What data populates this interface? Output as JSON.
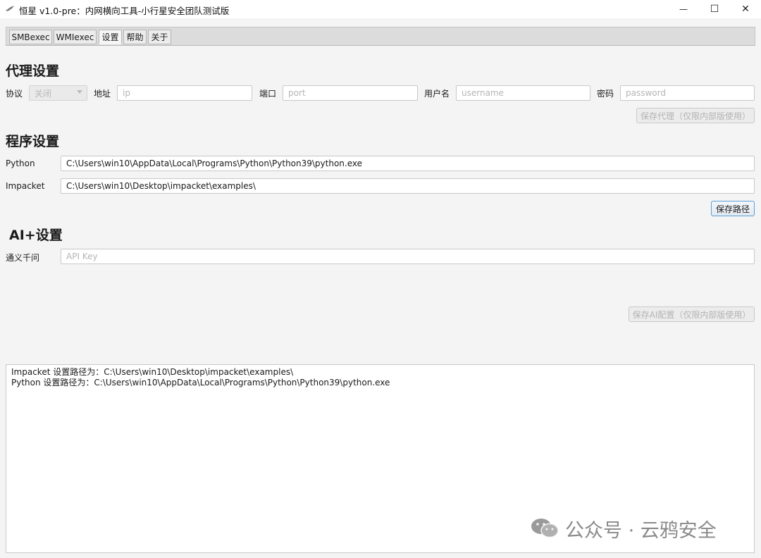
{
  "window": {
    "title": "恒星 v1.0-pre：内网横向工具-小行星安全团队测试版",
    "controls": {
      "minimize": "—",
      "maximize": "☐",
      "close": "✕"
    }
  },
  "tabs": [
    {
      "label": "SMBexec",
      "active": false
    },
    {
      "label": "WMIexec",
      "active": false
    },
    {
      "label": "设置",
      "active": true
    },
    {
      "label": "帮助",
      "active": false
    },
    {
      "label": "关于",
      "active": false
    }
  ],
  "proxy": {
    "heading": "代理设置",
    "protocol_label": "协议",
    "protocol_value": "关闭",
    "address_label": "地址",
    "address_placeholder": "ip",
    "port_label": "端口",
    "port_placeholder": "port",
    "username_label": "用户名",
    "username_placeholder": "username",
    "password_label": "密码",
    "password_placeholder": "password",
    "save_label": "保存代理（仅限内部版使用）"
  },
  "program": {
    "heading": "程序设置",
    "python_label": "Python",
    "python_value": "C:\\Users\\win10\\AppData\\Local\\Programs\\Python\\Python39\\python.exe",
    "impacket_label": "Impacket",
    "impacket_value": "C:\\Users\\win10\\Desktop\\impacket\\examples\\",
    "save_label": "保存路径"
  },
  "ai": {
    "heading": "AI+设置",
    "qwen_label": "通义千问",
    "api_key_placeholder": "API Key",
    "save_label": "保存AI配置（仅限内部版使用）"
  },
  "log": {
    "lines": [
      "Impacket 设置路径为：C:\\Users\\win10\\Desktop\\impacket\\examples\\",
      "Python 设置路径为：C:\\Users\\win10\\AppData\\Local\\Programs\\Python\\Python39\\python.exe"
    ]
  },
  "watermark": {
    "text": "公众号 · 云鸦安全"
  },
  "colors": {
    "accent_border": "#5a9fd6",
    "background": "#f4f4f4",
    "tabbar": "#dcdcdc"
  }
}
